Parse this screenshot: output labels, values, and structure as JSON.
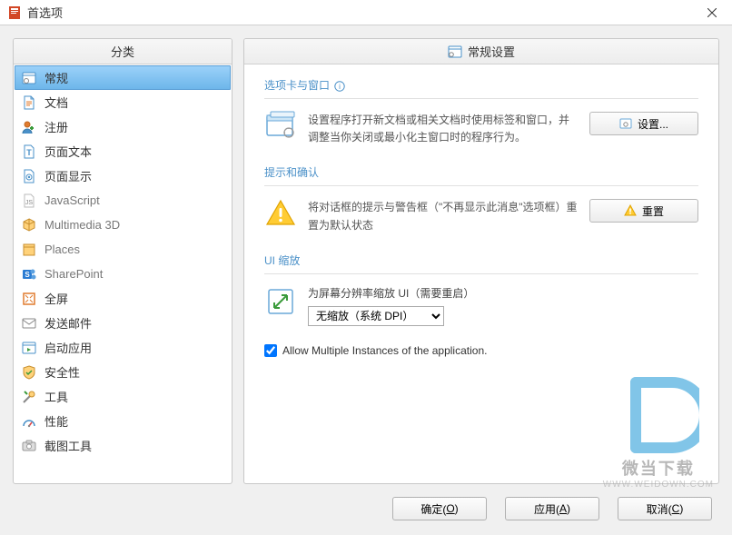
{
  "window": {
    "title": "首选项",
    "close": "×"
  },
  "sidebar": {
    "header": "分类",
    "items": [
      {
        "label": "常规",
        "icon": "general",
        "selected": true
      },
      {
        "label": "文档",
        "icon": "document"
      },
      {
        "label": "注册",
        "icon": "register"
      },
      {
        "label": "页面文本",
        "icon": "pagetext"
      },
      {
        "label": "页面显示",
        "icon": "pagedisplay"
      },
      {
        "label": "JavaScript",
        "icon": "js",
        "dim": true
      },
      {
        "label": "Multimedia 3D",
        "icon": "mm3d",
        "dim": true
      },
      {
        "label": "Places",
        "icon": "places",
        "dim": true
      },
      {
        "label": "SharePoint",
        "icon": "sharepoint",
        "dim": true
      },
      {
        "label": "全屏",
        "icon": "fullscreen"
      },
      {
        "label": "发送邮件",
        "icon": "mail"
      },
      {
        "label": "启动应用",
        "icon": "launch"
      },
      {
        "label": "安全性",
        "icon": "security"
      },
      {
        "label": "工具",
        "icon": "tools"
      },
      {
        "label": "性能",
        "icon": "performance"
      },
      {
        "label": "截图工具",
        "icon": "snapshot"
      }
    ]
  },
  "main": {
    "header": "常规设置",
    "sections": {
      "tabs": {
        "title": "选项卡与窗口",
        "info": true,
        "desc": "设置程序打开新文档或相关文档时使用标签和窗口，并调整当你关闭或最小化主窗口时的程序行为。",
        "button": "设置..."
      },
      "prompts": {
        "title": "提示和确认",
        "desc": "将对话框的提示与警告框（\"不再显示此消息\"选项框）重置为默认状态",
        "button": "重置"
      },
      "ui_scale": {
        "title": "UI 缩放",
        "label": "为屏幕分辨率缩放 UI（需要重启）",
        "options": [
          "无缩放（系统 DPI）"
        ],
        "selected": "无缩放（系统 DPI）"
      },
      "allow_multi": {
        "label": "Allow Multiple Instances of  the application.",
        "checked": true
      }
    }
  },
  "footer": {
    "ok": {
      "text": "确定(",
      "key": "O",
      "suffix": ")"
    },
    "apply": {
      "text": "应用(",
      "key": "A",
      "suffix": ")"
    },
    "cancel": {
      "text": "取消(",
      "key": "C",
      "suffix": ")"
    }
  },
  "watermark": {
    "text": "微当下载",
    "url": "WWW.WEIDOWN.COM"
  }
}
